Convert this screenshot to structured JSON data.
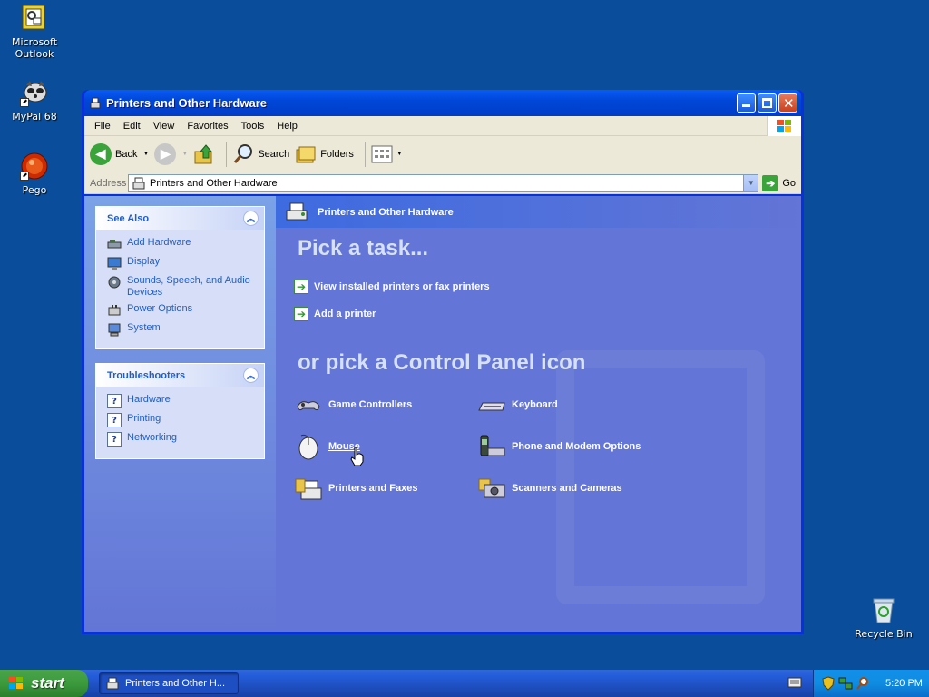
{
  "desktop": {
    "icons": [
      {
        "label": "Microsoft Outlook"
      },
      {
        "label": "MyPal 68"
      },
      {
        "label": "Pego"
      },
      {
        "label": "Recycle Bin"
      }
    ]
  },
  "window": {
    "title": "Printers and Other Hardware",
    "menu": [
      "File",
      "Edit",
      "View",
      "Favorites",
      "Tools",
      "Help"
    ],
    "toolbar": {
      "back": "Back",
      "search": "Search",
      "folders": "Folders"
    },
    "address": {
      "label": "Address",
      "value": "Printers and Other Hardware",
      "go": "Go"
    }
  },
  "see_also": {
    "title": "See Also",
    "links": [
      "Add Hardware",
      "Display",
      "Sounds, Speech, and Audio Devices",
      "Power Options",
      "System"
    ]
  },
  "troubleshooters": {
    "title": "Troubleshooters",
    "links": [
      "Hardware",
      "Printing",
      "Networking"
    ]
  },
  "main": {
    "header": "Printers and Other Hardware",
    "pick_task": "Pick a task...",
    "tasks": [
      "View installed printers or fax printers",
      "Add a printer"
    ],
    "pick_icon": "or pick a Control Panel icon",
    "icons": [
      "Game Controllers",
      "Keyboard",
      "Mouse",
      "Phone and Modem Options",
      "Printers and Faxes",
      "Scanners and Cameras"
    ]
  },
  "taskbar": {
    "start": "start",
    "item": "Printers and Other H...",
    "clock": "5:20 PM"
  },
  "colors": {
    "desktop": "#0a4e9b",
    "title_bar": "#0047d8",
    "main_pane": "#6375d6",
    "link": "#215dc6"
  }
}
